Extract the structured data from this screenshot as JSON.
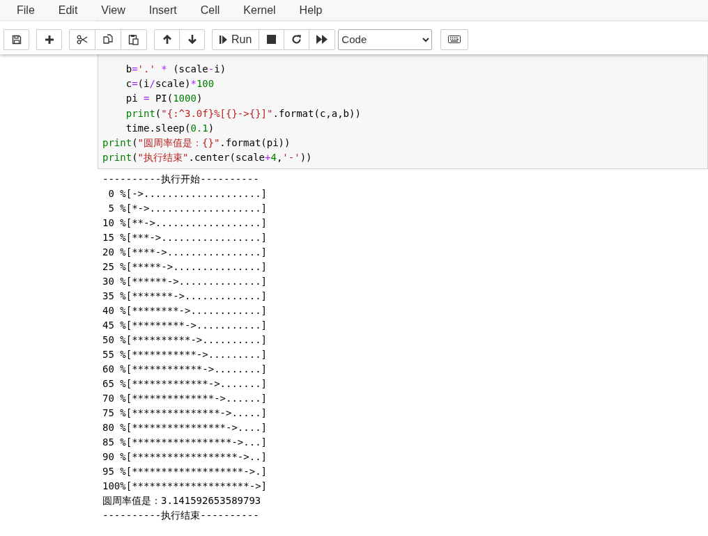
{
  "menu": [
    "File",
    "Edit",
    "View",
    "Insert",
    "Cell",
    "Kernel",
    "Help"
  ],
  "toolbar": {
    "run_label": "Run",
    "cell_type": "Code"
  },
  "code_cell": {
    "lines": [
      [
        {
          "kind": "text",
          "text": "    b"
        },
        {
          "kind": "op",
          "text": "="
        },
        {
          "kind": "string",
          "text": "'.'"
        },
        {
          "kind": "op",
          "text": " * "
        },
        {
          "kind": "text",
          "text": "(scale"
        },
        {
          "kind": "op",
          "text": "-"
        },
        {
          "kind": "text",
          "text": "i)"
        }
      ],
      [
        {
          "kind": "text",
          "text": "    c"
        },
        {
          "kind": "op",
          "text": "="
        },
        {
          "kind": "text",
          "text": "(i"
        },
        {
          "kind": "op",
          "text": "/"
        },
        {
          "kind": "text",
          "text": "scale)"
        },
        {
          "kind": "op",
          "text": "*"
        },
        {
          "kind": "number",
          "text": "100"
        }
      ],
      [
        {
          "kind": "text",
          "text": "    pi "
        },
        {
          "kind": "op",
          "text": "="
        },
        {
          "kind": "text",
          "text": " PI("
        },
        {
          "kind": "number",
          "text": "1000"
        },
        {
          "kind": "text",
          "text": ")"
        }
      ],
      [
        {
          "kind": "builtin",
          "text": "    print"
        },
        {
          "kind": "text",
          "text": "("
        },
        {
          "kind": "string",
          "text": "\"{:^3.0f}%[{}->{}]\""
        },
        {
          "kind": "text",
          "text": ".format(c,a,b))"
        }
      ],
      [
        {
          "kind": "text",
          "text": "    time.sleep("
        },
        {
          "kind": "number",
          "text": "0.1"
        },
        {
          "kind": "text",
          "text": ")"
        }
      ],
      [
        {
          "kind": "builtin",
          "text": "print"
        },
        {
          "kind": "text",
          "text": "("
        },
        {
          "kind": "string",
          "text": "\"圆周率值是：{}\""
        },
        {
          "kind": "text",
          "text": ".format(pi))"
        }
      ],
      [
        {
          "kind": "builtin",
          "text": "print"
        },
        {
          "kind": "text",
          "text": "("
        },
        {
          "kind": "string",
          "text": "\"执行结束\""
        },
        {
          "kind": "text",
          "text": ".center(scale"
        },
        {
          "kind": "op",
          "text": "+"
        },
        {
          "kind": "number",
          "text": "4"
        },
        {
          "kind": "text",
          "text": ","
        },
        {
          "kind": "string",
          "text": "'-'"
        },
        {
          "kind": "text",
          "text": "))"
        }
      ]
    ]
  },
  "output": [
    "----------执行开始----------",
    " 0 %[->....................]",
    " 5 %[*->...................]",
    "10 %[**->..................]",
    "15 %[***->.................]",
    "20 %[****->................]",
    "25 %[*****->...............]",
    "30 %[******->..............]",
    "35 %[*******->.............]",
    "40 %[********->............]",
    "45 %[*********->...........]",
    "50 %[**********->..........]",
    "55 %[***********->.........]",
    "60 %[************->........]",
    "65 %[*************->.......]",
    "70 %[**************->......]",
    "75 %[***************->.....]",
    "80 %[****************->....]",
    "85 %[*****************->...]",
    "90 %[******************->..]",
    "95 %[*******************->.]",
    "100%[********************->]",
    "圆周率值是：3.141592653589793",
    "----------执行结束----------"
  ]
}
